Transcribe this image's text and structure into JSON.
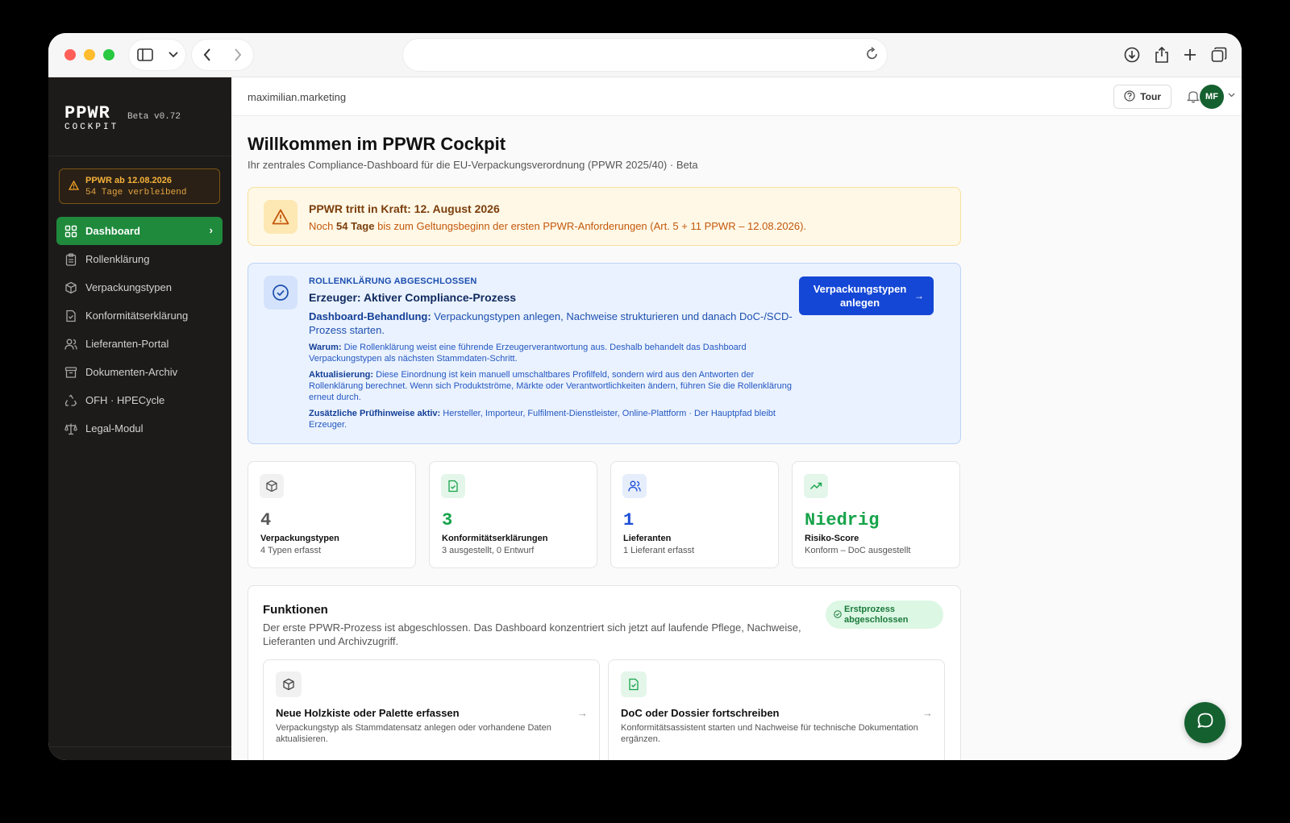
{
  "browser": {
    "url": ""
  },
  "sidebar": {
    "logo_line1": "PPWR",
    "logo_line2": "COCKPIT",
    "version": "Beta v0.72",
    "countdown_title": "PPWR ab 12.08.2026",
    "countdown_sub": "54 Tage verbleibend",
    "items": [
      {
        "label": "Dashboard",
        "icon": "grid-icon",
        "active": true
      },
      {
        "label": "Rollenklärung",
        "icon": "clipboard-icon"
      },
      {
        "label": "Verpackungstypen",
        "icon": "package-icon"
      },
      {
        "label": "Konformitätserklärung",
        "icon": "file-check-icon"
      },
      {
        "label": "Lieferanten-Portal",
        "icon": "users-icon"
      },
      {
        "label": "Dokumenten-Archiv",
        "icon": "archive-icon"
      },
      {
        "label": "OFH · HPECycle",
        "icon": "recycle-icon"
      },
      {
        "label": "Legal-Modul",
        "icon": "scale-icon"
      }
    ]
  },
  "topbar": {
    "org": "maximilian.marketing",
    "tour_label": "Tour",
    "avatar_initials": "MF"
  },
  "page": {
    "title": "Willkommen im PPWR Cockpit",
    "subtitle": "Ihr zentrales Compliance-Dashboard für die EU-Verpackungsverordnung (PPWR 2025/40) · Beta"
  },
  "alert": {
    "title": "PPWR tritt in Kraft: 12. August 2026",
    "prefix": "Noch",
    "days": "54",
    "days_label": "Tage",
    "suffix": "bis zum Geltungsbeginn der ersten PPWR-Anforderungen (Art. 5 + 11 PPWR – 12.08.2026)."
  },
  "role": {
    "kicker": "ROLLENKLÄRUNG ABGESCHLOSSEN",
    "title": "Erzeuger: Aktiver Compliance-Prozess",
    "p1_label": "Dashboard-Behandlung:",
    "p1_text": "Verpackungstypen anlegen, Nachweise strukturieren und danach DoC-/SCD-Prozess starten.",
    "p2_label": "Warum:",
    "p2_text": "Die Rollenklärung weist eine führende Erzeugerverantwortung aus. Deshalb behandelt das Dashboard Verpackungstypen als nächsten Stammdaten-Schritt.",
    "p3_label": "Aktualisierung:",
    "p3_text": "Diese Einordnung ist kein manuell umschaltbares Profilfeld, sondern wird aus den Antworten der Rollenklärung berechnet. Wenn sich Produktströme, Märkte oder Verantwortlichkeiten ändern, führen Sie die Rollenklärung erneut durch.",
    "p4_label": "Zusätzliche Prüfhinweise aktiv:",
    "p4_text": "Hersteller, Importeur, Fulfilment-Dienstleister, Online-Plattform · Der Hauptpfad bleibt Erzeuger.",
    "button_label": "Verpackungstypen anlegen"
  },
  "stats": [
    {
      "value": "4",
      "label": "Verpackungstypen",
      "sub": "4 Typen erfasst",
      "icon": "package-icon",
      "color": "#555555"
    },
    {
      "value": "3",
      "label": "Konformitätserklärungen",
      "sub": "3 ausgestellt, 0 Entwurf",
      "icon": "file-check-icon",
      "color": "#16a34a"
    },
    {
      "value": "1",
      "label": "Lieferanten",
      "sub": "1 Lieferant erfasst",
      "icon": "users-icon",
      "color": "#1d4ed8"
    },
    {
      "value": "Niedrig",
      "label": "Risiko-Score",
      "sub": "Konform – DoC ausgestellt",
      "icon": "trending-up-icon",
      "color": "#16a34a"
    }
  ],
  "functions": {
    "title": "Funktionen",
    "description": "Der erste PPWR-Prozess ist abgeschlossen. Das Dashboard konzentriert sich jetzt auf laufende Pflege, Nachweise, Lieferanten und Archivzugriff.",
    "badge": "Erstprozess abgeschlossen",
    "cards": [
      {
        "title": "Neue Holzkiste oder Palette erfassen",
        "sub": "Verpackungstyp als Stammdatensatz anlegen oder vorhandene Daten aktualisieren.",
        "icon": "package-icon"
      },
      {
        "title": "DoC oder Dossier fortschreiben",
        "sub": "Konformitätsassistent starten und Nachweise für technische Dokumentation ergänzen.",
        "icon": "file-check-icon"
      }
    ]
  },
  "colors": {
    "accent_green": "#1f8a3c",
    "brand_dark": "#15602f",
    "primary_blue": "#1447d6",
    "sidebar_bg": "#1d1b1a"
  }
}
